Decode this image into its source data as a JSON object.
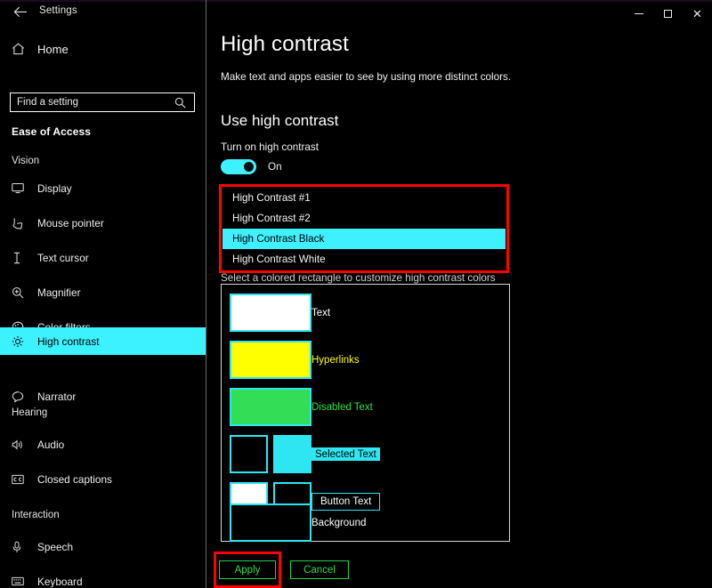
{
  "window": {
    "title": "Settings",
    "back_icon": "back-arrow-icon",
    "controls": {
      "minimize": "minimize-icon",
      "maximize": "maximize-icon",
      "close": "close-icon"
    }
  },
  "sidebar": {
    "home_label": "Home",
    "home_icon": "home-icon",
    "search": {
      "placeholder": "Find a setting",
      "value": "",
      "icon": "search-icon"
    },
    "category": "Ease of Access",
    "groups": [
      {
        "label": "Vision",
        "items": [
          {
            "label": "Display",
            "icon": "monitor-icon",
            "selected": false
          },
          {
            "label": "Mouse pointer",
            "icon": "mouse-pointer-icon",
            "selected": false
          },
          {
            "label": "Text cursor",
            "icon": "text-cursor-icon",
            "selected": false
          },
          {
            "label": "Magnifier",
            "icon": "magnifier-icon",
            "selected": false
          },
          {
            "label": "Color filters",
            "icon": "palette-icon",
            "selected": false
          },
          {
            "label": "High contrast",
            "icon": "sun-contrast-icon",
            "selected": true
          },
          {
            "label": "Narrator",
            "icon": "narrator-icon",
            "selected": false
          }
        ]
      },
      {
        "label": "Hearing",
        "items": [
          {
            "label": "Audio",
            "icon": "speaker-icon",
            "selected": false
          },
          {
            "label": "Closed captions",
            "icon": "closed-captions-icon",
            "selected": false
          }
        ]
      },
      {
        "label": "Interaction",
        "items": [
          {
            "label": "Speech",
            "icon": "microphone-icon",
            "selected": false
          },
          {
            "label": "Keyboard",
            "icon": "keyboard-icon",
            "selected": false
          }
        ]
      }
    ]
  },
  "main": {
    "page_title": "High contrast",
    "page_subtitle": "Make text and apps easier to see by using more distinct colors.",
    "section_title": "Use high contrast",
    "toggle_label": "Turn on high contrast",
    "toggle_state": "On",
    "theme_dropdown": {
      "selected": "High Contrast Black",
      "options": [
        "High Contrast #1",
        "High Contrast #2",
        "High Contrast Black",
        "High Contrast White"
      ]
    },
    "swatch_hint": "Select a colored rectangle to customize high contrast colors",
    "swatches": [
      {
        "caption": "Text",
        "style": "text",
        "colors": [
          "#ffffff"
        ]
      },
      {
        "caption": "Hyperlinks",
        "style": "link",
        "colors": [
          "#ffff00"
        ]
      },
      {
        "caption": "Disabled Text",
        "style": "dis",
        "colors": [
          "#33dd55"
        ]
      },
      {
        "caption": "Selected Text",
        "style": "sel",
        "colors": [
          "#000000",
          "#2ee6f2"
        ]
      },
      {
        "caption": "Button Text",
        "style": "btn",
        "colors": [
          "#ffffff",
          "#000000"
        ]
      },
      {
        "caption": "Background",
        "style": "bg",
        "colors": [
          "#000000"
        ]
      }
    ],
    "buttons": {
      "apply": "Apply",
      "cancel": "Cancel"
    }
  },
  "colors": {
    "accent_cyan": "#3df2ff",
    "highlight_red": "#fe0000",
    "button_green": "#22d04a",
    "swatch_border": "#2ee6f2",
    "background": "#000000"
  }
}
